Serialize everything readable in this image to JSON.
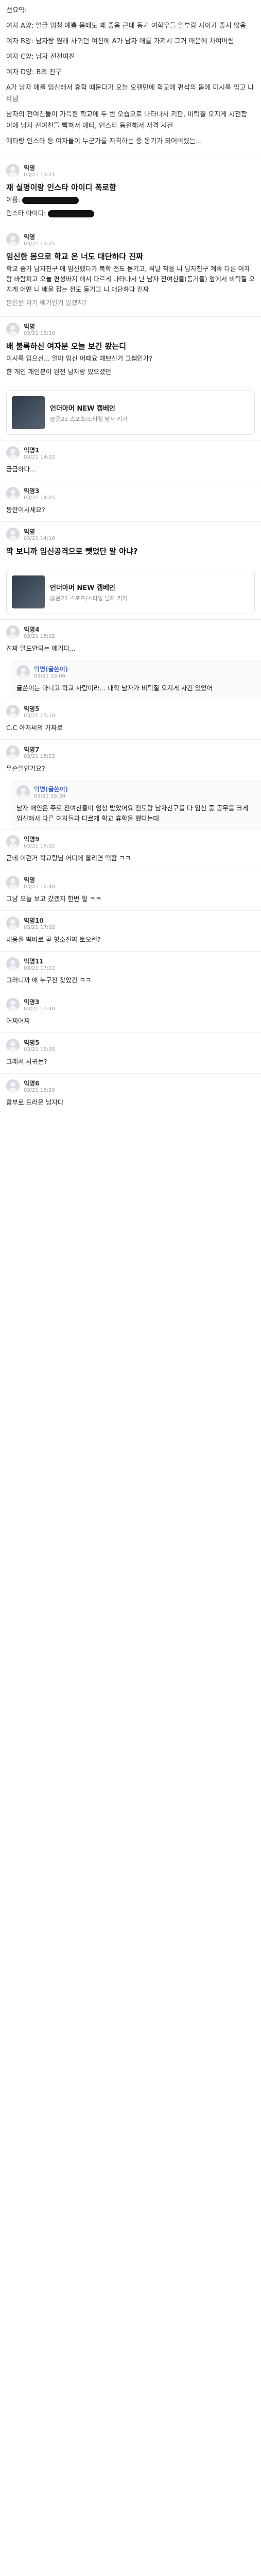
{
  "intro": {
    "lines": [
      "선요약:",
      "여자 A양: 얼굴 엄청 예쁨 몸매도 꽤 좋음 근데 동기 여학우들 일부랑 사이가 좋지 않음",
      "여자 B양: 남자랑 원래 사귀던 여친에 A가 남자 애를 가져서 그거 때문에 차여버림",
      "여자 C양: 남자 전전여친",
      "여자 D양: B의 친구",
      "A가 남자 애를 임신해서 휴학 때문다가 오늘 오랜만에 학교에 편삭의 몸에 미시룩 입고 나타남",
      "남자의 전여친들이 가득한 학교에 두 번 오습으로 나타나서 키판, 비틱질 오지게 시전함 이에 남자 전여친들 빡쳐서 에타, 인스타 동원해서 저격 시전",
      "에타랑 인스타 등 여자들이 누군가를 저격하는 중 동기가 되어버렸는..."
    ]
  },
  "posts": [
    {
      "name": "익명",
      "time": "03/21 13:21",
      "title": "재 실명이랑 인스타 아이디 폭로함",
      "body": [
        "이름: ",
        "인스타 아이디: "
      ],
      "likes": "",
      "comments": ""
    },
    {
      "name": "익명",
      "time": "03/21 13:25",
      "title": "임신한 몸으로 학교 온 너도 대단하다 진짜",
      "body": [
        "학교 좀가 남자친구 애 임신했다가 복학 전도 듣기고, 직날 착을 니 남자친구 계속 다른 여자랑 바람피고 오늘 편성바지 해서 다르게 나타나서 난 남자 전여친들(동기들) 앞에서 비틱질 오지게 어떤 니 배을 잡는 전도 동기고 니 대단하다 진짜",
        " ",
        "본인은 자기 얘기인거 알겠지?"
      ],
      "likes": "",
      "comments": ""
    },
    {
      "name": "익명",
      "time": "03/21 13:30",
      "title": "배 불룩하신 여자분 오늘 보긴 봤는디",
      "body": [
        "미시룩 입으신... 얼마 임신 어때요 예쁘신거 그쌤인가?",
        "한 개인 개인분이 완전 남자랑 있으셨던"
      ],
      "likes": "",
      "comments": ""
    }
  ],
  "ad": {
    "title": "언더아머 NEW 캡베인",
    "sub": "@윤21 스포츠/스타일 남자 키가"
  },
  "comments": [
    {
      "name": "익명1",
      "time": "03/21 14:02",
      "body": "궁금하다..."
    },
    {
      "name": "익명3",
      "time": "03/21 14:05",
      "body": "동란이시세요?"
    },
    {
      "name": "익명",
      "time": "03/21 14:10",
      "body": "딱 보니까 임신공격으로 뺏었단 말 아냐?"
    }
  ],
  "reply_thread": [
    {
      "name": "익명4",
      "time": "03/21 15:02",
      "body": "진짜 말도안되는 애기다...",
      "op": false
    },
    {
      "name": "익명(글쓴이)",
      "time": "03/21 15:06",
      "body": "글쓴이는 아니고 학교 사람이라... 대학 남자가 비틱질 오지게 사건 있었어",
      "op": true
    },
    {
      "name": "익명5",
      "time": "03/21 15:10",
      "body": "C.C 아저씨의 가짜로",
      "op": false
    },
    {
      "name": "익명7",
      "time": "03/21 15:22",
      "body": "무슨일인거요?",
      "op": false
    },
    {
      "name": "익명(글쓴이)",
      "time": "03/21 15:30",
      "body": "남자 애인은 주로 전여친들이 엄청 받았어요 전도랑 남자친구를 다 임신 중 공무를 크게 임신해서 다른 여자들과 다르게 학교 휴학을 했다는데",
      "op": true
    },
    {
      "name": "익명9",
      "time": "03/21 16:02",
      "body": "근데 이런거 학교랑님 어디에 올리면 떡함 ㅋㅋ",
      "op": false
    },
    {
      "name": "익명",
      "time": "03/21 16:40",
      "body": "그냥 오늘 보고 갔겠지 한번 헐 ㅋㅋ",
      "op": false
    },
    {
      "name": "익명10",
      "time": "03/21 17:02",
      "body": "내용을 떡바로 곧 항소진짜 토오런?",
      "op": false
    },
    {
      "name": "익명11",
      "time": "03/21 17:22",
      "body": "그러니까 애 누구진 찾았긴 ㅋㅋ",
      "op": false
    },
    {
      "name": "익명3",
      "time": "03/21 17:40",
      "body": "어찌어찌",
      "op": false
    },
    {
      "name": "익명5",
      "time": "03/21 18:05",
      "body": "그래서 사귀는?",
      "op": false
    },
    {
      "name": "익명6",
      "time": "03/21 18:20",
      "body": "함부로 드러운 남자다",
      "op": false
    }
  ]
}
